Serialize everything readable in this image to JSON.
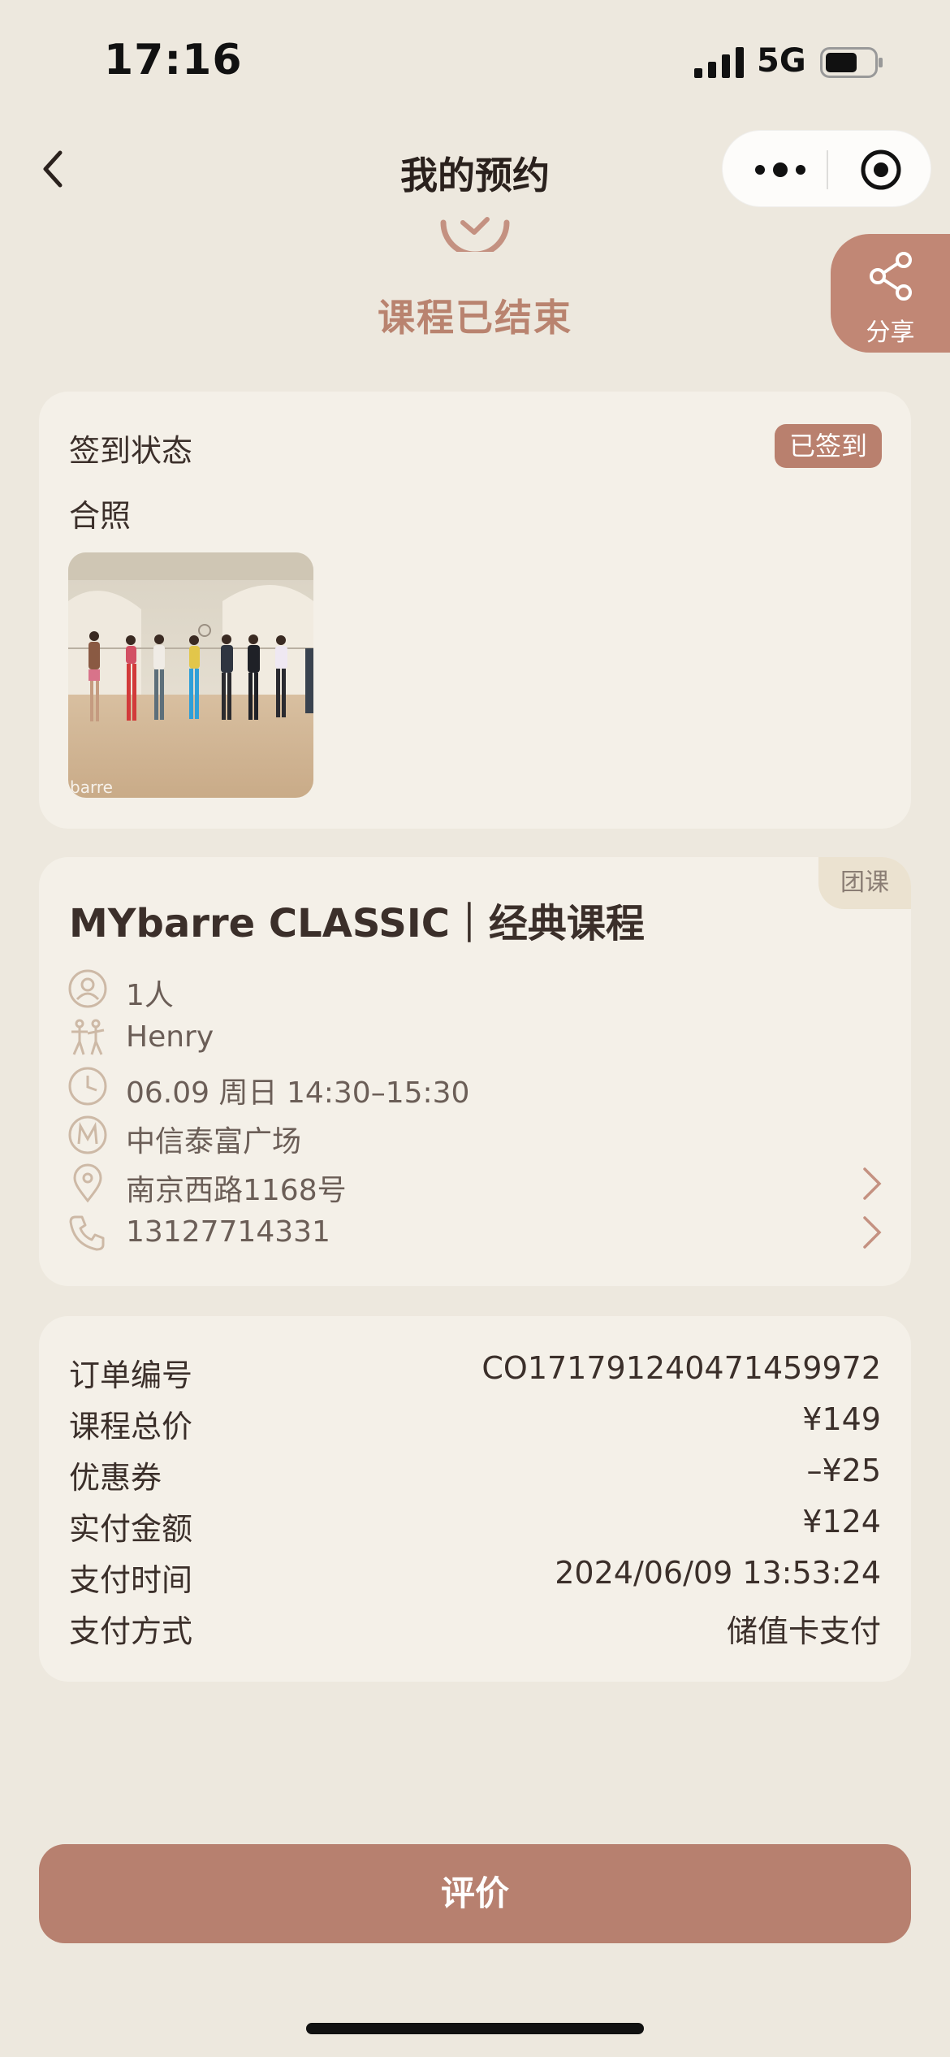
{
  "status_bar": {
    "time": "17:16",
    "network": "5G"
  },
  "nav": {
    "title": "我的预约"
  },
  "course_status": "课程已结束",
  "share": {
    "label": "分享"
  },
  "checkin": {
    "label": "签到状态",
    "badge": "已签到",
    "photo_label": "合照",
    "photo_watermark": "barre"
  },
  "course": {
    "tag": "团课",
    "name": "MYbarre CLASSIC｜经典课程",
    "people": "1人",
    "instructor": "Henry",
    "time": "06.09 周日 14:30–15:30",
    "venue": "中信泰富广场",
    "address": "南京西路1168号",
    "phone": "13127714331"
  },
  "order": {
    "rows": [
      {
        "key": "订单编号",
        "value": "CO171791240471459972"
      },
      {
        "key": "课程总价",
        "value": "¥149"
      },
      {
        "key": "优惠券",
        "value": "–¥25"
      },
      {
        "key": "实付金额",
        "value": "¥124"
      },
      {
        "key": "支付时间",
        "value": "2024/06/09 13:53:24"
      },
      {
        "key": "支付方式",
        "value": "储值卡支付"
      }
    ]
  },
  "actions": {
    "review_label": "评价"
  },
  "colors": {
    "accent": "#b7806f",
    "background": "#ede8de",
    "card": "#f4f0e8"
  }
}
